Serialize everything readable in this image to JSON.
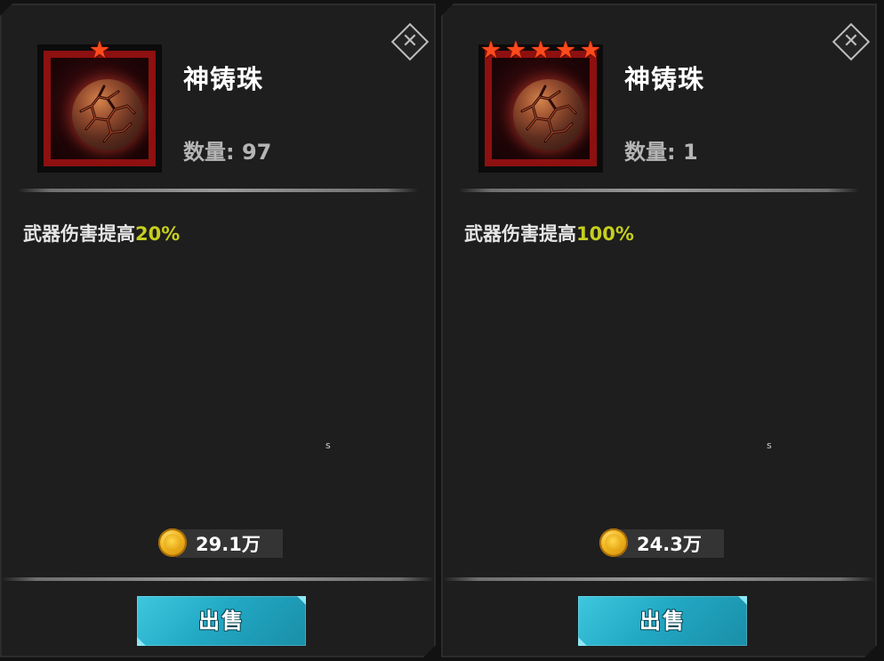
{
  "colors": {
    "star": "#ff4a1c",
    "highlight": "#c6cf1d",
    "sell_button": "#22a9c4",
    "frame_border": "#8e1010",
    "coin": "#f1b51c"
  },
  "icons": {
    "close": "close-icon",
    "star": "star-icon",
    "coin": "coin-icon",
    "item": "forge-orb-icon"
  },
  "panels": [
    {
      "star_count": 1,
      "stars": [
        "★"
      ],
      "item_name": "神铸珠",
      "quantity_label": "数量: 97",
      "description": {
        "prefix": "武器伤害提高",
        "value": "20%"
      },
      "tiny_text": "s",
      "price": "29.1万",
      "sell_label": "出售",
      "close_glyph": "✕"
    },
    {
      "star_count": 5,
      "stars": [
        "★",
        "★",
        "★",
        "★",
        "★"
      ],
      "item_name": "神铸珠",
      "quantity_label": "数量: 1",
      "description": {
        "prefix": "武器伤害提高",
        "value": "100%"
      },
      "tiny_text": "s",
      "price": "24.3万",
      "sell_label": "出售",
      "close_glyph": "✕"
    }
  ]
}
